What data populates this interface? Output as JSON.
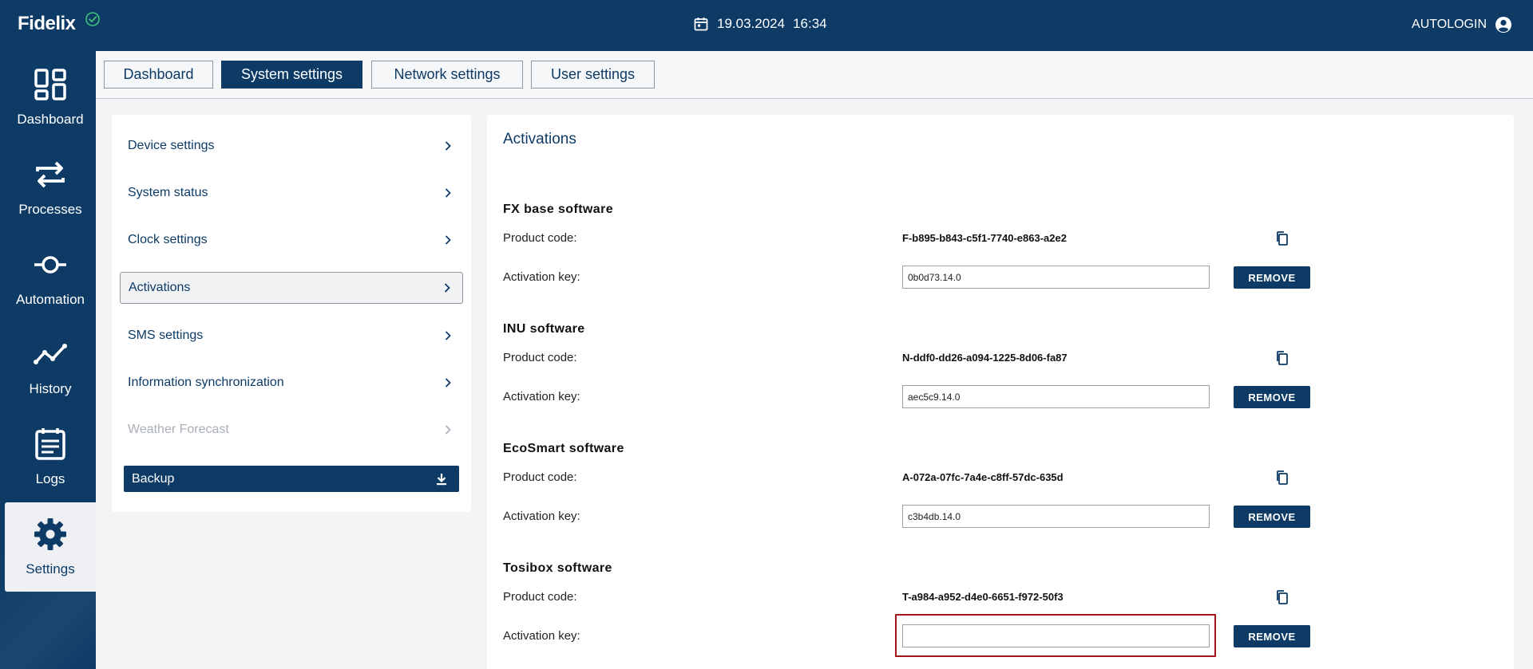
{
  "topbar": {
    "brand": "Fidelix",
    "date": "19.03.2024",
    "time": "16:34",
    "user": "AUTOLOGIN"
  },
  "leftnav": {
    "items": [
      {
        "label": "Dashboard",
        "icon": "dashboard-icon"
      },
      {
        "label": "Processes",
        "icon": "processes-icon"
      },
      {
        "label": "Automation",
        "icon": "automation-icon"
      },
      {
        "label": "History",
        "icon": "history-icon"
      },
      {
        "label": "Logs",
        "icon": "logs-icon"
      },
      {
        "label": "Settings",
        "icon": "settings-icon",
        "active": true
      }
    ]
  },
  "tabs": [
    {
      "label": "Dashboard"
    },
    {
      "label": "System settings",
      "active": true
    },
    {
      "label": "Network settings"
    },
    {
      "label": "User settings"
    }
  ],
  "submenu": {
    "items": [
      {
        "label": "Device settings"
      },
      {
        "label": "System status"
      },
      {
        "label": "Clock settings"
      },
      {
        "label": "Activations",
        "active": true
      },
      {
        "label": "SMS settings"
      },
      {
        "label": "Information synchronization"
      },
      {
        "label": "Weather Forecast",
        "disabled": true
      }
    ],
    "backup_label": "Backup"
  },
  "main": {
    "title": "Activations",
    "product_code_label": "Product code:",
    "activation_key_label": "Activation key:",
    "remove_label": "REMOVE",
    "sections": [
      {
        "title": "FX base software",
        "product_code": "F-b895-b843-c5f1-7740-e863-a2e2",
        "activation_key": "0b0d73.14.0"
      },
      {
        "title": "INU software",
        "product_code": "N-ddf0-dd26-a094-1225-8d06-fa87",
        "activation_key": "aec5c9.14.0"
      },
      {
        "title": "EcoSmart software",
        "product_code": "A-072a-07fc-7a4e-c8ff-57dc-635d",
        "activation_key": "c3b4db.14.0"
      },
      {
        "title": "Tosibox software",
        "product_code": "T-a984-a952-d4e0-6651-f972-50f3",
        "activation_key": ""
      }
    ]
  },
  "colors": {
    "primary": "#0d3b66",
    "highlight": "#a4161a",
    "disabled_text": "#aab0b8"
  }
}
